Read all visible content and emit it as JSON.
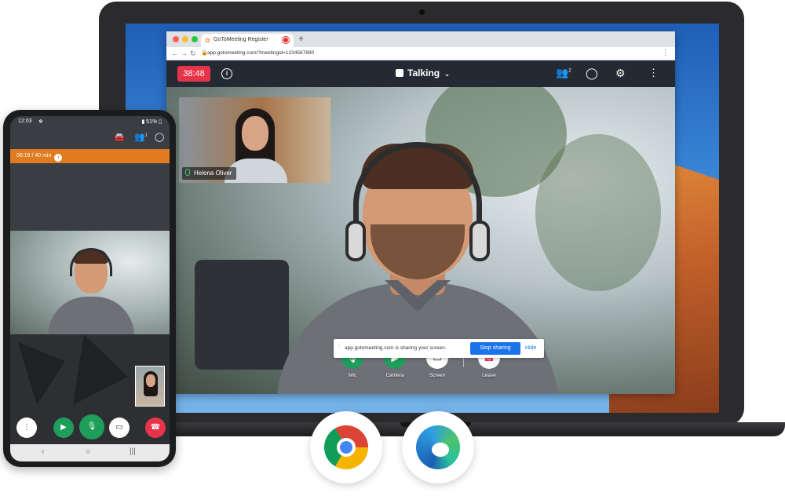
{
  "browser": {
    "tab_title": "GoToMeeting Register",
    "url": "app.gotomeeting.com/?meetingid=1234567890",
    "new_tab_symbol": "+"
  },
  "meeting": {
    "timer": "38:48",
    "view_label": "Talking",
    "participants_count": "2",
    "thumbnail_name": "Helena Oliver",
    "controls": {
      "mic": "Mic",
      "camera": "Camera",
      "screen": "Screen",
      "leave": "Leave"
    },
    "share_notice": {
      "text": "app.gotomeeting.com is sharing your screen.",
      "stop_label": "Stop sharing",
      "hide_label": "Hide"
    }
  },
  "phone": {
    "time": "12:03",
    "battery": "51%",
    "participants_count": "1",
    "timer_text": "00:19 / 40 min"
  },
  "colors": {
    "timer_red": "#e8344a",
    "mic_green": "#1e9e5a",
    "leave_red": "#e8344a",
    "share_blue": "#1a73e8",
    "phone_timer_orange": "#e07c1f"
  }
}
